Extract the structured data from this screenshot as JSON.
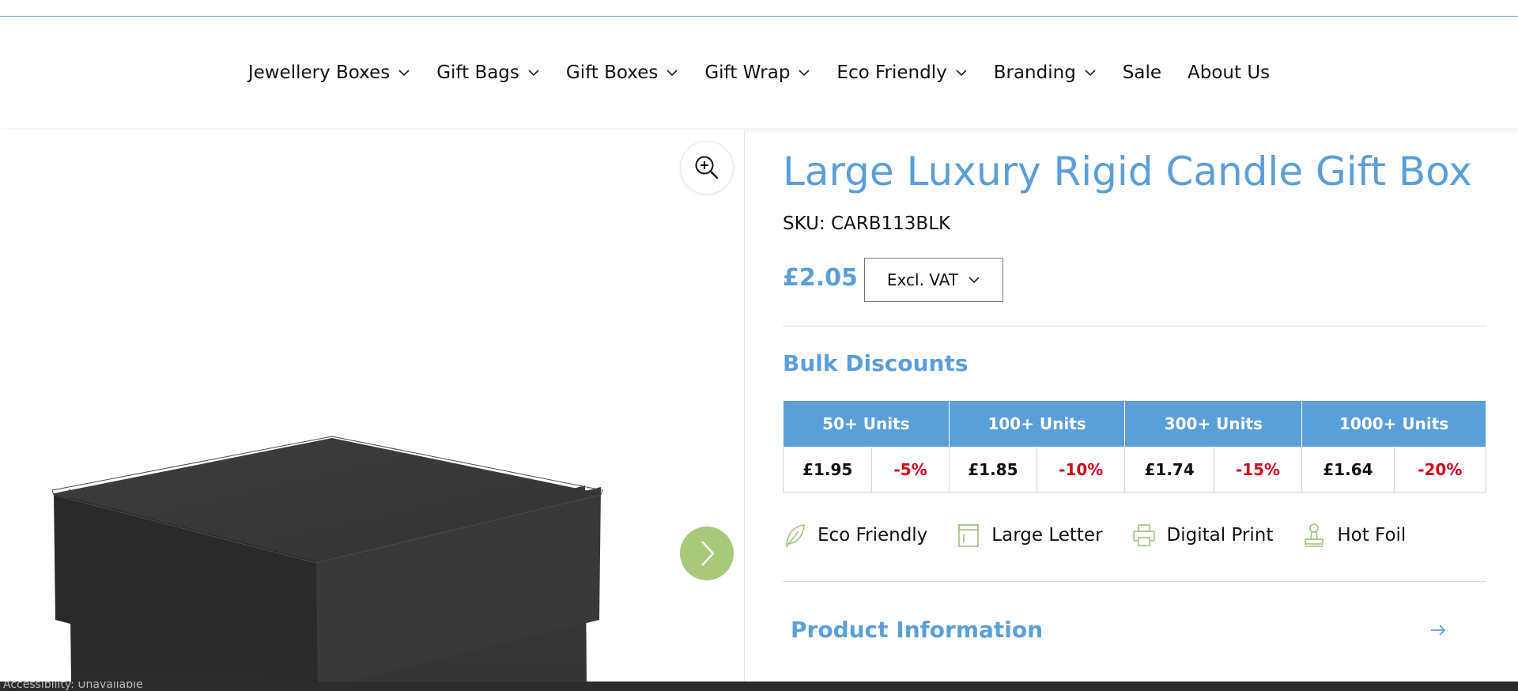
{
  "nav": {
    "items": [
      {
        "label": "Jewellery Boxes",
        "dropdown": true
      },
      {
        "label": "Gift Bags",
        "dropdown": true
      },
      {
        "label": "Gift Boxes",
        "dropdown": true
      },
      {
        "label": "Gift Wrap",
        "dropdown": true
      },
      {
        "label": "Eco Friendly",
        "dropdown": true
      },
      {
        "label": "Branding",
        "dropdown": true
      },
      {
        "label": "Sale",
        "dropdown": false
      },
      {
        "label": "About Us",
        "dropdown": false
      }
    ]
  },
  "product": {
    "title": "Large Luxury Rigid Candle Gift Box",
    "sku": "SKU: CARB113BLK",
    "price": "£2.05",
    "vat_option": "Excl. VAT"
  },
  "bulk": {
    "heading": "Bulk Discounts",
    "tiers": [
      {
        "label": "50+ Units",
        "price": "£1.95",
        "discount": "-5%"
      },
      {
        "label": "100+ Units",
        "price": "£1.85",
        "discount": "-10%"
      },
      {
        "label": "300+ Units",
        "price": "£1.74",
        "discount": "-15%"
      },
      {
        "label": "1000+ Units",
        "price": "£1.64",
        "discount": "-20%"
      }
    ]
  },
  "features": [
    {
      "label": "Eco Friendly",
      "icon": "leaf-icon"
    },
    {
      "label": "Large Letter",
      "icon": "letter-box-icon"
    },
    {
      "label": "Digital Print",
      "icon": "printer-icon"
    },
    {
      "label": "Hot Foil",
      "icon": "stamp-icon"
    }
  ],
  "product_info": {
    "label": "Product Information"
  },
  "status_bar": {
    "text": "Accessibility: Unavailable"
  },
  "colors": {
    "accent": "#5b9fd8",
    "discount": "#d0021b",
    "next_button": "#a9c97a",
    "box": "#2f2f2f"
  }
}
